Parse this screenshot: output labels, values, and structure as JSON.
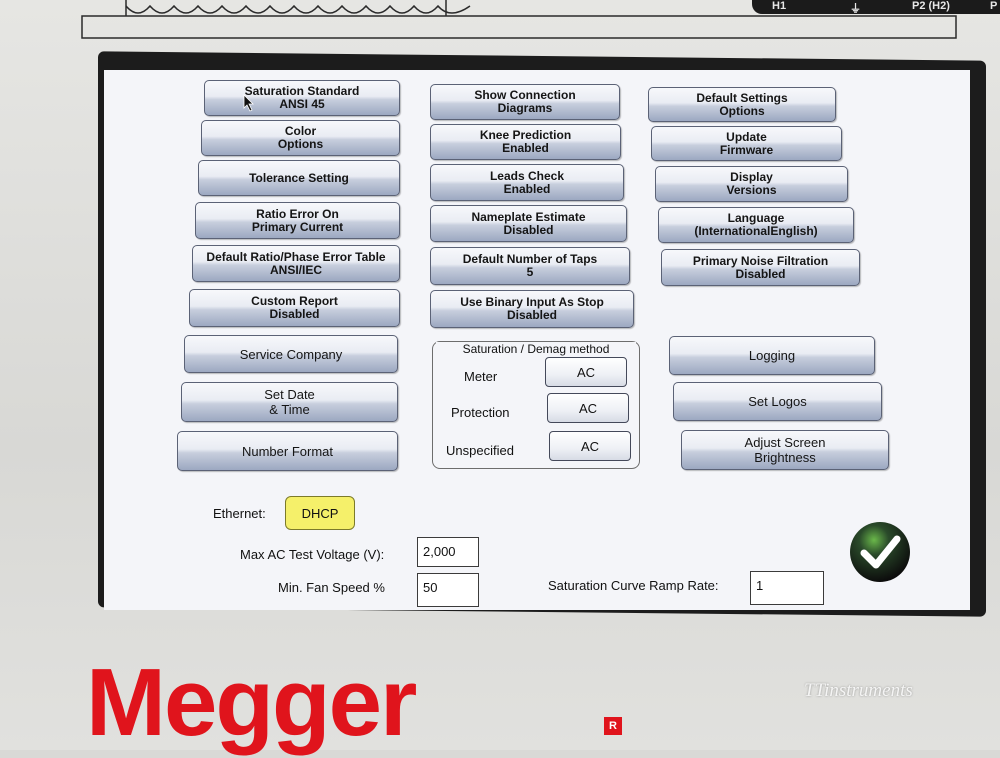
{
  "device": {
    "terminals": [
      "H1",
      "⏚",
      "P2 (H2)",
      "P"
    ],
    "brand": "Megger",
    "brand_mark": "R",
    "watermark": "TTinstruments"
  },
  "menu": {
    "col1": [
      {
        "line1": "Saturation Standard",
        "line2": "ANSI 45"
      },
      {
        "line1": "Color",
        "line2": "Options"
      },
      {
        "line1": "Tolerance Setting",
        "line2": ""
      },
      {
        "line1": "Ratio Error On",
        "line2": "Primary Current"
      },
      {
        "line1": "Default Ratio/Phase Error Table",
        "line2": "ANSI/IEC"
      },
      {
        "line1": "Custom Report",
        "line2": "Disabled"
      },
      {
        "line1": "Service Company",
        "line2": ""
      },
      {
        "line1": "Set Date",
        "line2": "& Time"
      },
      {
        "line1": "Number Format",
        "line2": ""
      }
    ],
    "col2": [
      {
        "line1": "Show Connection",
        "line2": "Diagrams"
      },
      {
        "line1": "Knee Prediction",
        "line2": "Enabled"
      },
      {
        "line1": "Leads Check",
        "line2": "Enabled"
      },
      {
        "line1": "Nameplate Estimate",
        "line2": "Disabled"
      },
      {
        "line1": "Default Number of Taps",
        "line2": "5"
      },
      {
        "line1": "Use Binary Input As Stop",
        "line2": "Disabled"
      }
    ],
    "col3": [
      {
        "line1": "Default Settings",
        "line2": "Options"
      },
      {
        "line1": "Update",
        "line2": "Firmware"
      },
      {
        "line1": "Display",
        "line2": "Versions"
      },
      {
        "line1": "Language",
        "line2": "(InternationalEnglish)"
      },
      {
        "line1": "Primary Noise Filtration",
        "line2": "Disabled"
      },
      {
        "line1": "Logging",
        "line2": ""
      },
      {
        "line1": "Set Logos",
        "line2": ""
      },
      {
        "line1": "Adjust Screen",
        "line2": "Brightness"
      }
    ]
  },
  "demag": {
    "title": "Saturation / Demag method",
    "rows": [
      {
        "label": "Meter",
        "value": "AC"
      },
      {
        "label": "Protection",
        "value": "AC"
      },
      {
        "label": "Unspecified",
        "value": "AC"
      }
    ]
  },
  "settings": {
    "ethernet_label": "Ethernet:",
    "ethernet_value": "DHCP",
    "ethernet_color": "#f5f06a",
    "max_voltage_label": "Max AC Test Voltage (V):",
    "max_voltage_value": "2,000",
    "fan_label": "Min. Fan Speed %",
    "fan_value": "50",
    "ramp_label": "Saturation Curve Ramp Rate:",
    "ramp_value": "1"
  },
  "confirm": {
    "icon": "check-icon"
  }
}
